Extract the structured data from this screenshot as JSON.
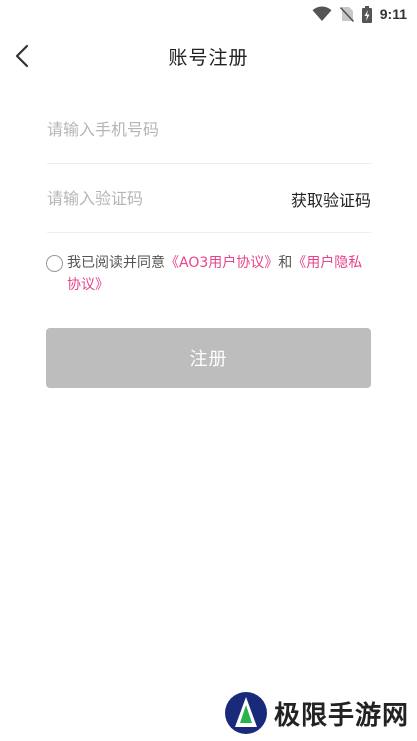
{
  "statusbar": {
    "time": "9:11",
    "icons": [
      "wifi-icon",
      "no-sim-icon",
      "battery-charging-icon"
    ]
  },
  "header": {
    "title": "账号注册",
    "back_icon": "chevron-left-icon"
  },
  "form": {
    "phone_placeholder": "请输入手机号码",
    "phone_value": "",
    "code_placeholder": "请输入验证码",
    "code_value": "",
    "get_code_label": "获取验证码"
  },
  "agreement": {
    "checked": false,
    "prefix": "我已阅读并同意",
    "user_agreement": "《AO3用户协议》",
    "conjunction": "和",
    "privacy_policy": "《用户隐私协议》"
  },
  "register_button": {
    "label": "注册"
  },
  "watermark": {
    "text": "极限手游网"
  },
  "colors": {
    "link": "#e8438c",
    "button_disabled": "#bdbdbd",
    "divider": "#eeeeee",
    "placeholder": "#b5b5b5"
  }
}
